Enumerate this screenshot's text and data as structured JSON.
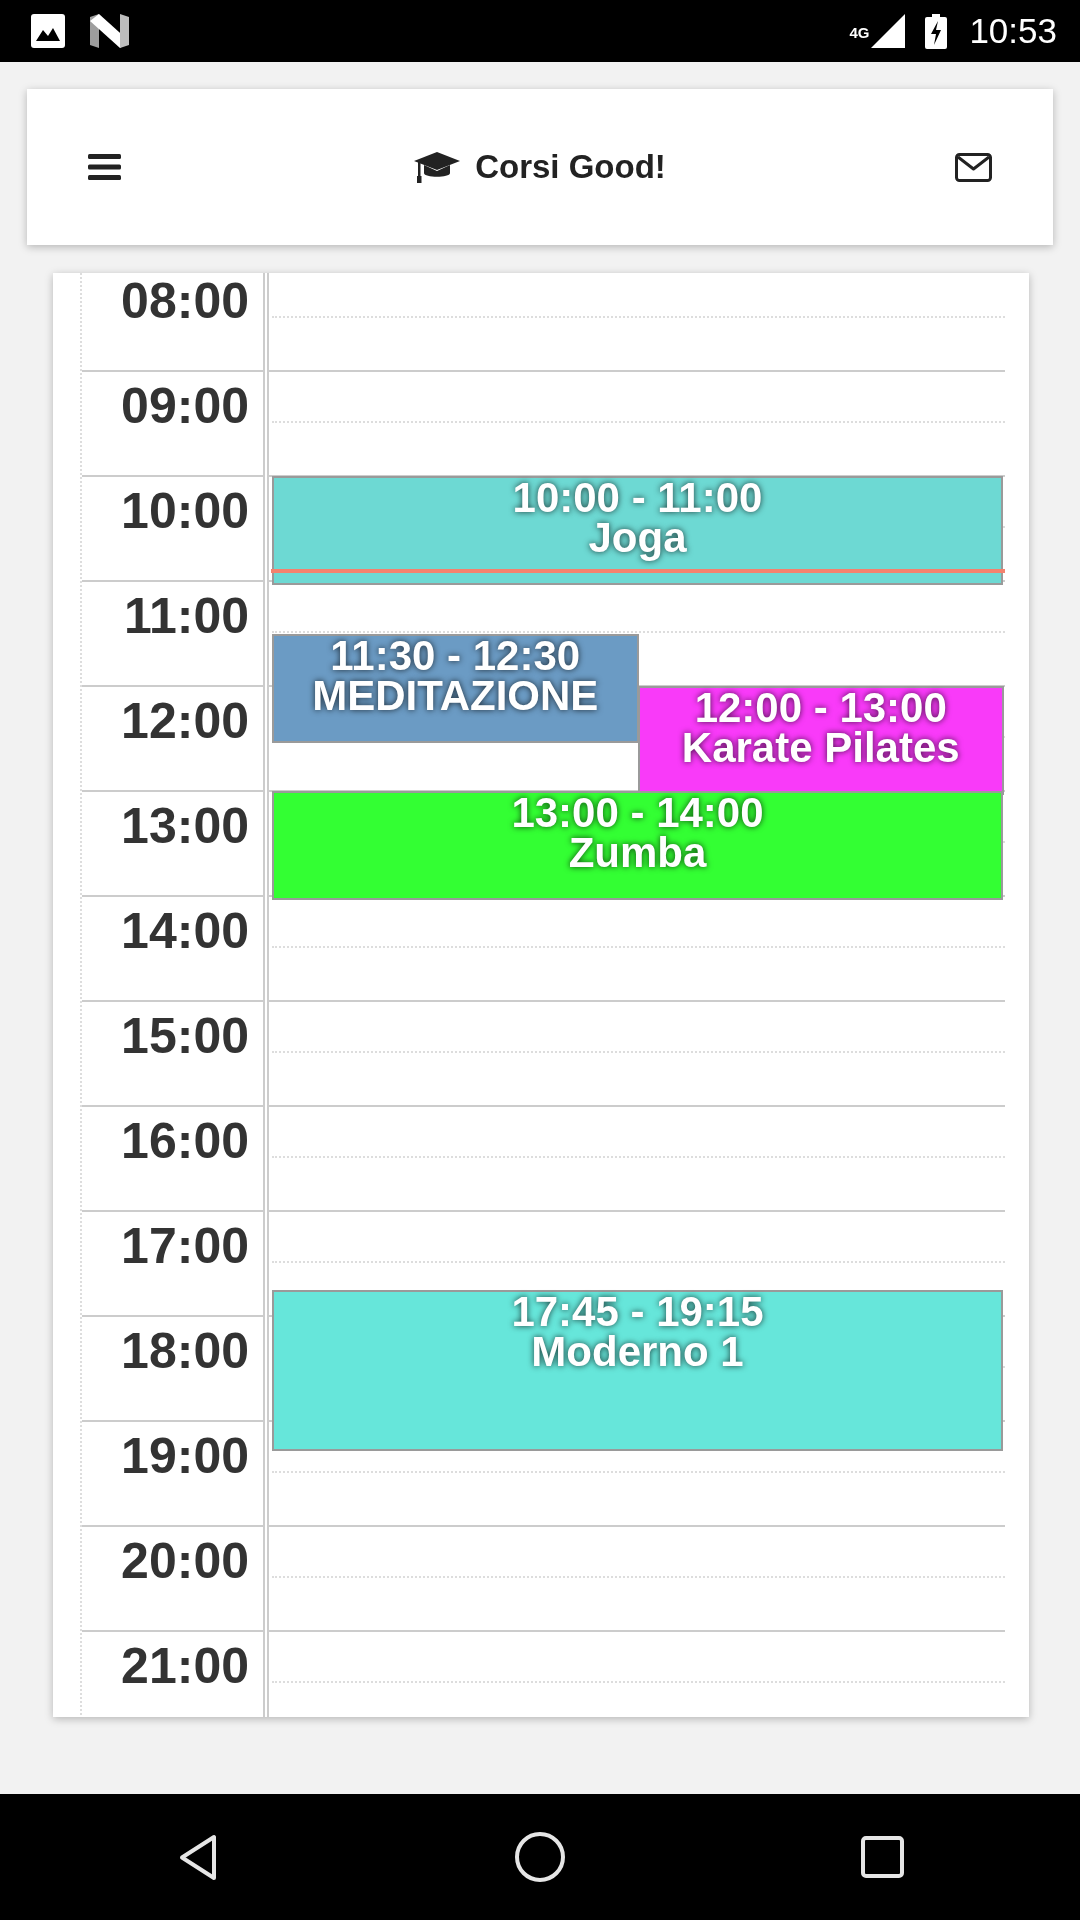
{
  "status_bar": {
    "network": "4G",
    "time": "10:53"
  },
  "header": {
    "title": "Corsi Good!"
  },
  "calendar": {
    "hours": [
      "08:00",
      "09:00",
      "10:00",
      "11:00",
      "12:00",
      "13:00",
      "14:00",
      "15:00",
      "16:00",
      "17:00",
      "18:00",
      "19:00",
      "20:00",
      "21:00"
    ],
    "now_line": true,
    "events": [
      {
        "time": "10:00 - 11:00",
        "title": "Joga",
        "color": "#6dd9d3"
      },
      {
        "time": "11:30 - 12:30",
        "title": "MEDITAZIONE",
        "color": "#6b9bc4"
      },
      {
        "time": "12:00 - 13:00",
        "title": "Karate Pilates",
        "color": "#f93af9"
      },
      {
        "time": "13:00 - 14:00",
        "title": "Zumba",
        "color": "#33ff33"
      },
      {
        "time": "17:45 - 19:15",
        "title": "Moderno 1",
        "color": "#66e6da"
      }
    ]
  }
}
